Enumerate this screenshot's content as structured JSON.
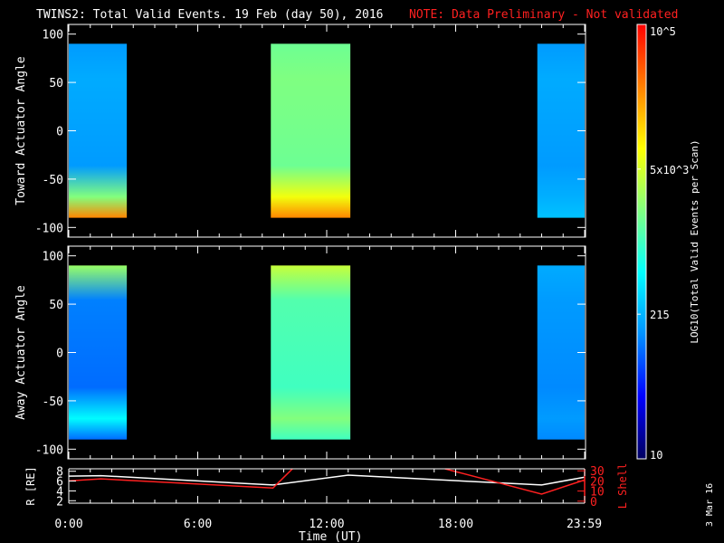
{
  "chart_data": {
    "type": "heatmap",
    "title": "TWINS2: Total Valid Events. 19 Feb (day  50), 2016",
    "note": "NOTE: Data Preliminary - Not validated",
    "date_stamp": "3 Mar 16",
    "xlabel": "Time (UT)",
    "x_ticks": [
      "0:00",
      "6:00",
      "12:00",
      "18:00",
      "23:59"
    ],
    "x_tick_hours": [
      0,
      6,
      12,
      18,
      23.98
    ],
    "xlim_hours": [
      0,
      24
    ],
    "panels": [
      {
        "ylabel": "Toward Actuator Angle",
        "ylim": [
          -110,
          110
        ],
        "y_ticks": [
          "100",
          "50",
          "0",
          "-50",
          "-100"
        ],
        "y_tick_values": [
          100,
          50,
          0,
          -50,
          -100
        ],
        "data_blocks": [
          {
            "t_start": 0.0,
            "t_end": 2.7,
            "angle_range": [
              -90,
              90
            ],
            "level_low_angle": 0.85,
            "level_high_angle": 0.3
          },
          {
            "t_start": 9.4,
            "t_end": 13.1,
            "angle_range": [
              -90,
              90
            ],
            "level_low_angle": 0.85,
            "level_high_angle": 0.55
          },
          {
            "t_start": 21.8,
            "t_end": 24.0,
            "angle_range": [
              -90,
              90
            ],
            "level_low_angle": 0.35,
            "level_high_angle": 0.3
          }
        ]
      },
      {
        "ylabel": "Away Actuator Angle",
        "ylim": [
          -110,
          110
        ],
        "y_ticks": [
          "100",
          "50",
          "0",
          "-50",
          "-100"
        ],
        "y_tick_values": [
          100,
          50,
          0,
          -50,
          -100
        ],
        "data_blocks": [
          {
            "t_start": 0.0,
            "t_end": 2.7,
            "angle_range": [
              -90,
              90
            ],
            "level_low_angle": 0.25,
            "level_high_angle": 0.6
          },
          {
            "t_start": 9.4,
            "t_end": 13.1,
            "angle_range": [
              -90,
              90
            ],
            "level_low_angle": 0.5,
            "level_high_angle": 0.65
          },
          {
            "t_start": 21.8,
            "t_end": 24.0,
            "angle_range": [
              -90,
              90
            ],
            "level_low_angle": 0.28,
            "level_high_angle": 0.32
          }
        ]
      }
    ],
    "colorbar": {
      "label": "LOG10(Total Valid Events per Scan)",
      "range": [
        10,
        100000
      ],
      "ticks": [
        "10",
        "215",
        "5x10^3",
        "10^5"
      ],
      "tick_fractions": [
        0,
        0.333,
        0.667,
        1
      ],
      "colors": [
        "#000060",
        "#0000ff",
        "#0090ff",
        "#00ffff",
        "#80ff80",
        "#ffff00",
        "#ff8000",
        "#ff0000"
      ]
    },
    "orbit": {
      "left_label": "R [RE]",
      "right_label": "L Shell",
      "r_ticks": [
        "8",
        "6",
        "4",
        "2"
      ],
      "r_tick_values": [
        8,
        6,
        4,
        2
      ],
      "r_lim": [
        1.5,
        8.5
      ],
      "l_ticks": [
        "30",
        "20",
        "10",
        "0"
      ],
      "l_tick_values": [
        30,
        20,
        10,
        0
      ],
      "l_lim": [
        -2,
        32
      ],
      "r_series": {
        "name": "R",
        "color": "#ffffff",
        "t": [
          0,
          1.5,
          9.5,
          13,
          22,
          24
        ],
        "values": [
          7.0,
          7.1,
          5.2,
          7.2,
          5.2,
          6.8
        ]
      },
      "l_series": [
        {
          "name": "L Shell",
          "color": "#ff2020",
          "t": [
            0,
            1.5,
            9.5,
            10.5
          ],
          "values": [
            20,
            22,
            13,
            34
          ]
        },
        {
          "name": "L Shell",
          "color": "#ff2020",
          "t": [
            17.5,
            22,
            24
          ],
          "values": [
            32,
            7,
            21
          ]
        }
      ]
    }
  }
}
